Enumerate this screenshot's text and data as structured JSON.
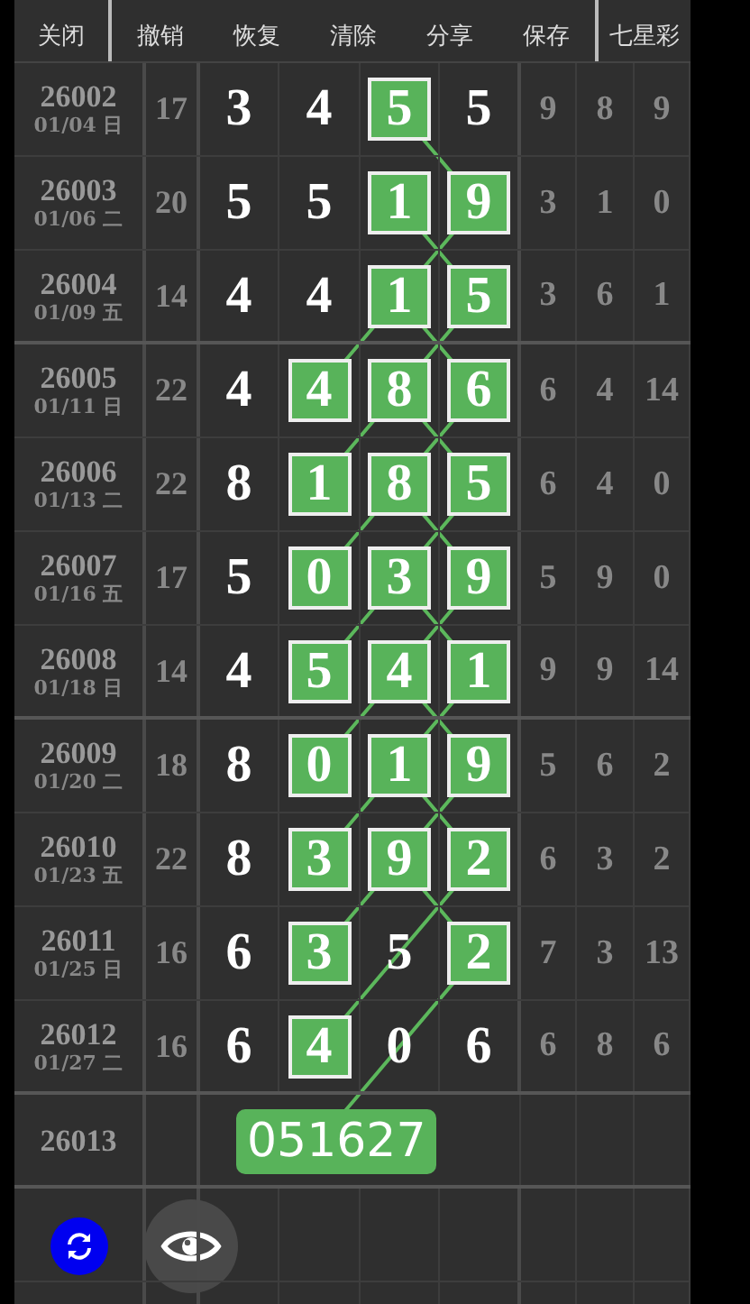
{
  "toolbar": [
    {
      "label": "关闭"
    },
    {
      "label": "撤销"
    },
    {
      "label": "恢复"
    },
    {
      "label": "清除"
    },
    {
      "label": "分享"
    },
    {
      "label": "保存"
    },
    {
      "label": "七星彩"
    }
  ],
  "rows": [
    {
      "issue": "26002",
      "date": "01/04 日",
      "sum": "17",
      "digits": [
        {
          "value": "3",
          "highlighted": false
        },
        {
          "value": "4",
          "highlighted": false
        },
        {
          "value": "5",
          "highlighted": true
        },
        {
          "value": "5",
          "highlighted": false
        }
      ],
      "extras": [
        "9",
        "8",
        "9"
      ]
    },
    {
      "issue": "26003",
      "date": "01/06 二",
      "sum": "20",
      "digits": [
        {
          "value": "5",
          "highlighted": false
        },
        {
          "value": "5",
          "highlighted": false
        },
        {
          "value": "1",
          "highlighted": true
        },
        {
          "value": "9",
          "highlighted": true
        }
      ],
      "extras": [
        "3",
        "1",
        "0"
      ]
    },
    {
      "issue": "26004",
      "date": "01/09 五",
      "sum": "14",
      "digits": [
        {
          "value": "4",
          "highlighted": false
        },
        {
          "value": "4",
          "highlighted": false
        },
        {
          "value": "1",
          "highlighted": true
        },
        {
          "value": "5",
          "highlighted": true
        }
      ],
      "extras": [
        "3",
        "6",
        "1"
      ]
    },
    {
      "issue": "26005",
      "date": "01/11 日",
      "sum": "22",
      "digits": [
        {
          "value": "4",
          "highlighted": false
        },
        {
          "value": "4",
          "highlighted": true
        },
        {
          "value": "8",
          "highlighted": true
        },
        {
          "value": "6",
          "highlighted": true
        }
      ],
      "extras": [
        "6",
        "4",
        "14"
      ]
    },
    {
      "issue": "26006",
      "date": "01/13 二",
      "sum": "22",
      "digits": [
        {
          "value": "8",
          "highlighted": false
        },
        {
          "value": "1",
          "highlighted": true
        },
        {
          "value": "8",
          "highlighted": true
        },
        {
          "value": "5",
          "highlighted": true
        }
      ],
      "extras": [
        "6",
        "4",
        "0"
      ]
    },
    {
      "issue": "26007",
      "date": "01/16 五",
      "sum": "17",
      "digits": [
        {
          "value": "5",
          "highlighted": false
        },
        {
          "value": "0",
          "highlighted": true
        },
        {
          "value": "3",
          "highlighted": true
        },
        {
          "value": "9",
          "highlighted": true
        }
      ],
      "extras": [
        "5",
        "9",
        "0"
      ]
    },
    {
      "issue": "26008",
      "date": "01/18 日",
      "sum": "14",
      "digits": [
        {
          "value": "4",
          "highlighted": false
        },
        {
          "value": "5",
          "highlighted": true
        },
        {
          "value": "4",
          "highlighted": true
        },
        {
          "value": "1",
          "highlighted": true
        }
      ],
      "extras": [
        "9",
        "9",
        "14"
      ]
    },
    {
      "issue": "26009",
      "date": "01/20 二",
      "sum": "18",
      "digits": [
        {
          "value": "8",
          "highlighted": false
        },
        {
          "value": "0",
          "highlighted": true
        },
        {
          "value": "1",
          "highlighted": true
        },
        {
          "value": "9",
          "highlighted": true
        }
      ],
      "extras": [
        "5",
        "6",
        "2"
      ]
    },
    {
      "issue": "26010",
      "date": "01/23 五",
      "sum": "22",
      "digits": [
        {
          "value": "8",
          "highlighted": false
        },
        {
          "value": "3",
          "highlighted": true
        },
        {
          "value": "9",
          "highlighted": true
        },
        {
          "value": "2",
          "highlighted": true
        }
      ],
      "extras": [
        "6",
        "3",
        "2"
      ]
    },
    {
      "issue": "26011",
      "date": "01/25 日",
      "sum": "16",
      "digits": [
        {
          "value": "6",
          "highlighted": false
        },
        {
          "value": "3",
          "highlighted": true
        },
        {
          "value": "5",
          "highlighted": false
        },
        {
          "value": "2",
          "highlighted": true
        }
      ],
      "extras": [
        "7",
        "3",
        "13"
      ]
    },
    {
      "issue": "26012",
      "date": "01/27 二",
      "sum": "16",
      "digits": [
        {
          "value": "6",
          "highlighted": false
        },
        {
          "value": "4",
          "highlighted": true
        },
        {
          "value": "0",
          "highlighted": false
        },
        {
          "value": "6",
          "highlighted": false
        }
      ],
      "extras": [
        "6",
        "8",
        "6"
      ]
    }
  ],
  "prediction": {
    "issue": "26013",
    "value": "051627"
  }
}
